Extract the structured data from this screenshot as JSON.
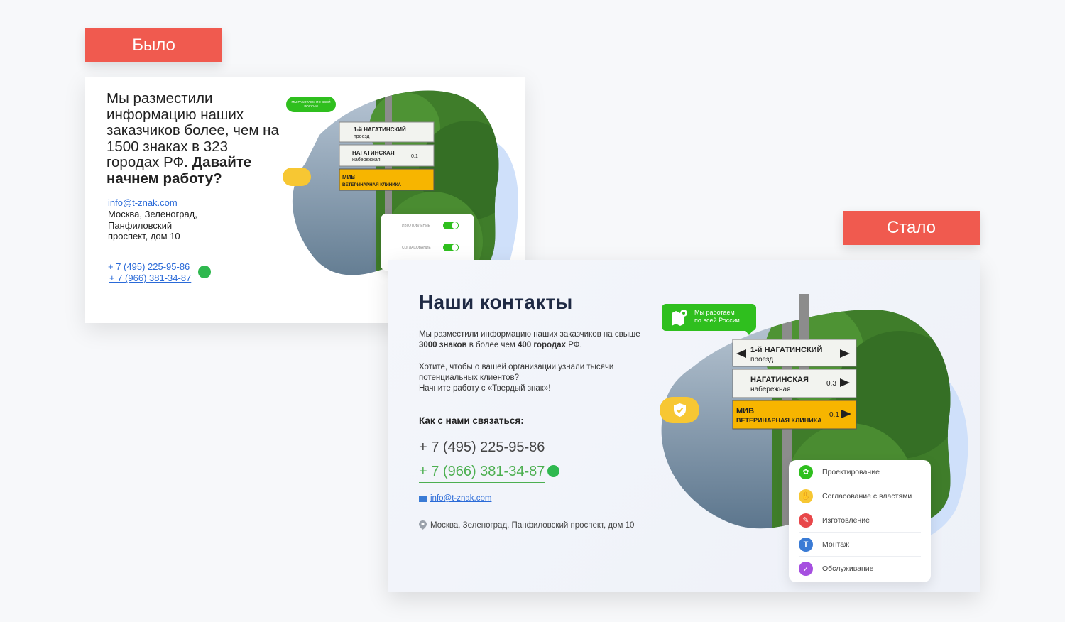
{
  "labels": {
    "before": "Было",
    "after": "Стало"
  },
  "before": {
    "heading_regular": "Мы разместили информацию наших заказчиков более, чем на 1500 знаках в 323 городах РФ. ",
    "heading_bold": "Давайте начнем работу?",
    "email": "info@t-znak.com",
    "address": "Москва, Зеленоград, Панфиловский проспект, дом 10",
    "phone1": "+ 7 (495) 225-95-86",
    "phone2": "+ 7 (966) 381-34-87",
    "badge": "МЫ РАБОТАЕМ ПО ВСЕЙ РОССИИ",
    "panel_rows": [
      "ИЗГОТОВЛЕНИЕ",
      "СОГЛАСОВАНИЕ"
    ],
    "signs": [
      {
        "title": "1-й НАГАТИНСКИЙ",
        "sub": "проезд",
        "dist": ""
      },
      {
        "title": "НАГАТИНСКАЯ",
        "sub": "набережная",
        "dist": "0.3"
      },
      {
        "title": "МИВ",
        "sub": "ВЕТЕРИНАРНАЯ КЛИНИКА",
        "dist": "0.1"
      }
    ]
  },
  "after": {
    "title": "Наши контакты",
    "p1_a": "Мы разместили информацию наших заказчиков на свыше ",
    "p1_b1": "3000 знаков",
    "p1_c": " в более чем ",
    "p1_b2": "400 городах",
    "p1_d": " РФ.",
    "p2_l1": "Хотите, чтобы о вашей организации узнали тысячи",
    "p2_l2": "потенциальных клиентов?",
    "p2_l3": "Начните работу с «Твердый знак»!",
    "how": "Как с нами связаться:",
    "phone1": "+ 7 (495) 225-95-86",
    "phone2": "+ 7 (966) 381-34-87",
    "email": "info@t-znak.com",
    "address": "Москва, Зеленоград, Панфиловский проспект, дом 10",
    "badge_l1": "Мы работаем",
    "badge_l2": "по всей России",
    "signs": [
      {
        "title": "1-й НАГАТИНСКИЙ",
        "sub": "проезд",
        "dist": ""
      },
      {
        "title": "НАГАТИНСКАЯ",
        "sub": "набережная",
        "dist": "0.3"
      },
      {
        "title": "МИВ",
        "sub": "ВЕТЕРИНАРНАЯ КЛИНИКА",
        "dist": "0.1"
      }
    ],
    "services": [
      {
        "label": "Проектирование",
        "color": "#2fbf1e",
        "icon": "gear-icon"
      },
      {
        "label": "Согласование с властями",
        "color": "#f7c733",
        "icon": "thumbs-up-icon"
      },
      {
        "label": "Изготовление",
        "color": "#e8474a",
        "icon": "wrench-icon"
      },
      {
        "label": "Монтаж",
        "color": "#3a7bd5",
        "icon": "t-icon"
      },
      {
        "label": "Обслуживание",
        "color": "#a64fe0",
        "icon": "shield-check-icon"
      }
    ]
  },
  "colors": {
    "accent_red": "#f05a4f",
    "green": "#2fbf1e",
    "link_blue": "#2a6ad8",
    "yellow": "#f7c733"
  }
}
